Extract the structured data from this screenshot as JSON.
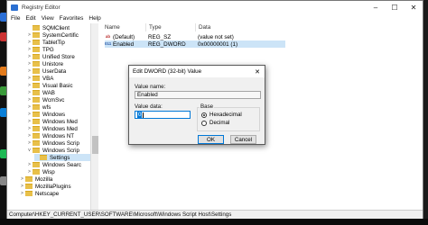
{
  "window": {
    "title": "Registry Editor"
  },
  "menu": [
    "File",
    "Edit",
    "View",
    "Favorites",
    "Help"
  ],
  "tree": {
    "items": [
      {
        "label": "SQMClient",
        "expand": ""
      },
      {
        "label": "SystemCertific",
        "expand": ">"
      },
      {
        "label": "TabletTip",
        "expand": ">"
      },
      {
        "label": "TPG",
        "expand": ">"
      },
      {
        "label": "Unified Store",
        "expand": ">"
      },
      {
        "label": "Unistore",
        "expand": ">"
      },
      {
        "label": "UserData",
        "expand": ">"
      },
      {
        "label": "VBA",
        "expand": ">"
      },
      {
        "label": "Visual Basic",
        "expand": ">"
      },
      {
        "label": "WAB",
        "expand": ">"
      },
      {
        "label": "WcmSvc",
        "expand": ">"
      },
      {
        "label": "wfs",
        "expand": ">"
      },
      {
        "label": "Windows",
        "expand": ">"
      },
      {
        "label": "Windows Med",
        "expand": ">"
      },
      {
        "label": "Windows Med",
        "expand": ">"
      },
      {
        "label": "Windows NT",
        "expand": ">"
      },
      {
        "label": "Windows Scrip",
        "expand": ">"
      },
      {
        "label": "Windows Scrip",
        "expand": "v"
      },
      {
        "label": "Settings",
        "expand": ""
      },
      {
        "label": "Windows Searc",
        "expand": ">"
      },
      {
        "label": "Wisp",
        "expand": ">"
      },
      {
        "label": "Mozilla",
        "expand": ">"
      },
      {
        "label": "MozillaPlugins",
        "expand": ">"
      },
      {
        "label": "Netscape",
        "expand": ">"
      }
    ]
  },
  "list": {
    "columns": [
      "Name",
      "Type",
      "Data"
    ],
    "rows": [
      {
        "name": "(Default)",
        "type": "REG_SZ",
        "data": "(value not set)",
        "icon": "ab"
      },
      {
        "name": "Enabled",
        "type": "REG_DWORD",
        "data": "0x00000001 (1)",
        "icon": "011"
      }
    ]
  },
  "status": {
    "path": "Computer\\HKEY_CURRENT_USER\\SOFTWARE\\Microsoft\\Windows Script Host\\Settings"
  },
  "dialog": {
    "title": "Edit DWORD (32-bit) Value",
    "value_name_label": "Value name:",
    "value_name": "Enabled",
    "value_data_label": "Value data:",
    "value_data": "0",
    "base_label": "Base",
    "base_options": [
      "Hexadecimal",
      "Decimal"
    ],
    "selected_base": "Hexadecimal",
    "ok_label": "OK",
    "cancel_label": "Cancel"
  },
  "colors": {
    "selection": "#cce4f7",
    "folder": "#e8c04a",
    "accent": "#0078d7"
  }
}
